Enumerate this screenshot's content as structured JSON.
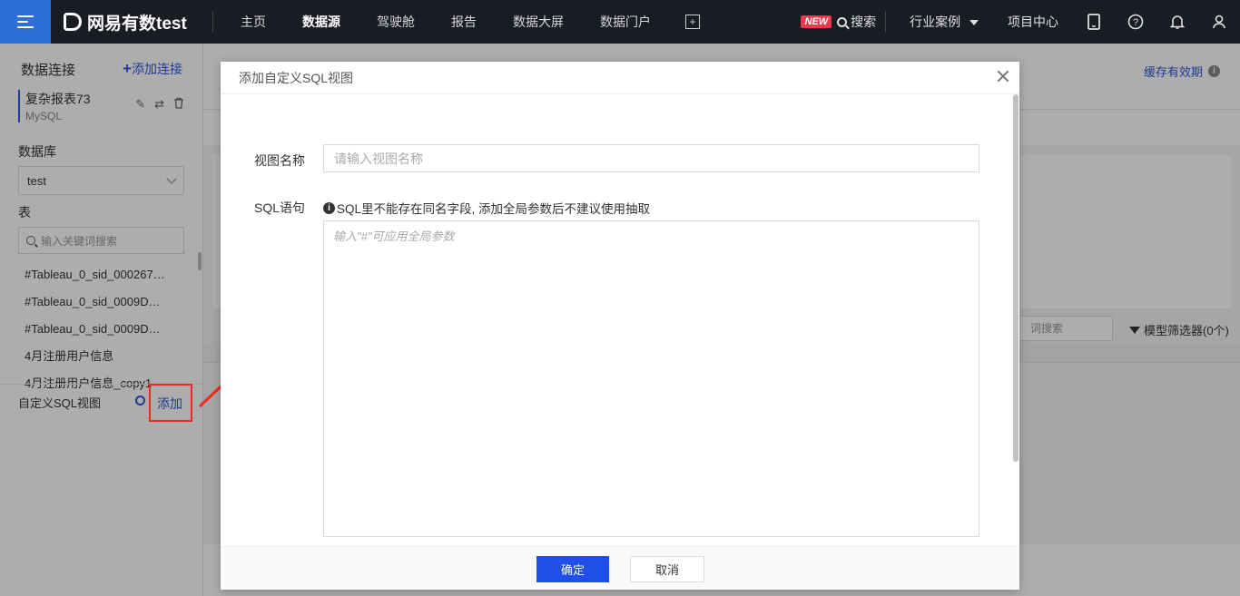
{
  "topnav": {
    "brand": "网易有数test",
    "items": [
      "主页",
      "数据源",
      "驾驶舱",
      "报告",
      "数据大屏",
      "数据门户"
    ],
    "active_index": 1,
    "new_badge": "NEW",
    "search_label": "搜索",
    "industry_cases": "行业案例",
    "project_center": "项目中心",
    "help_icon": "?"
  },
  "sidebar": {
    "title": "数据连接",
    "add_connection": "添加连接",
    "connection": {
      "name": "复杂报表73",
      "type": "MySQL"
    },
    "database_label": "数据库",
    "database_value": "test",
    "table_label": "表",
    "table_search_placeholder": "输入关键词搜索",
    "tables": [
      "#Tableau_0_sid_000267…",
      "#Tableau_0_sid_0009D…",
      "#Tableau_0_sid_0009D…",
      "4月注册用户信息",
      "4月注册用户信息_copy1"
    ],
    "custom_sql_label": "自定义SQL视图",
    "custom_sql_add": "添加"
  },
  "main": {
    "cache_link": "缓存有效期",
    "info_mark": "i",
    "keyword_search": "词搜索",
    "model_filter": "模型筛选器(0个)"
  },
  "dialog": {
    "title": "添加自定义SQL视图",
    "name_label": "视图名称",
    "name_placeholder": "请输入视图名称",
    "sql_label": "SQL语句",
    "sql_tip": "SQL里不能存在同名字段, 添加全局参数后不建议使用抽取",
    "tip_mark": "i",
    "sql_placeholder": "输入\"#\"可应用全局参数",
    "ok": "确定",
    "cancel": "取消"
  },
  "colors": {
    "accent": "#2b57d9",
    "primary_button": "#1f4ee8",
    "annotation": "#f0281e",
    "nav_bg": "#1a1c24"
  }
}
